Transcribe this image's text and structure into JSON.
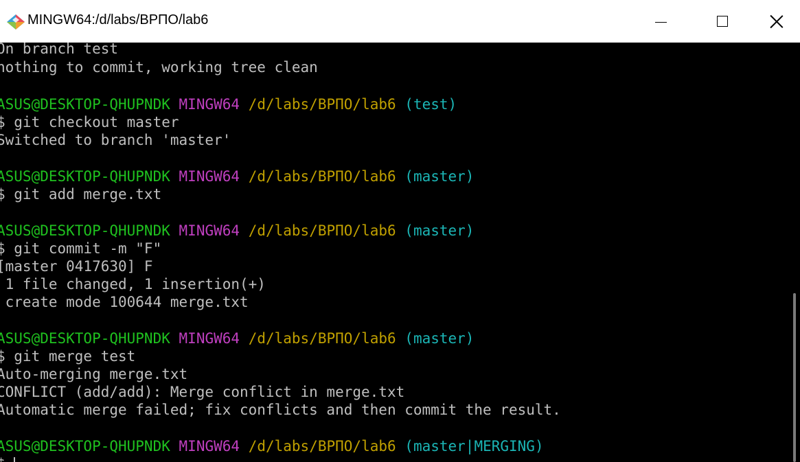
{
  "window": {
    "title": "MINGW64:/d/labs/ВРПО/lab6",
    "icon": "git-bash-icon",
    "controls": [
      "minimize-icon",
      "maximize-icon",
      "close-icon"
    ]
  },
  "colors": {
    "user": "#1fc11f",
    "system": "#bf3fbf",
    "path": "#c0a000",
    "branch": "#1bb5b5",
    "text": "#bfbfbf",
    "background": "#000000"
  },
  "terminal": {
    "line1": "On branch test",
    "line2": "nothing to commit, working tree clean",
    "prompt1": {
      "user": "ASUS@DESKTOP-QHUPNDK",
      "system": "MINGW64",
      "path": "/d/labs/ВРПО/lab6",
      "branch": "(test)"
    },
    "cmd1": "$ git checkout master",
    "out1": "Switched to branch 'master'",
    "prompt2": {
      "user": "ASUS@DESKTOP-QHUPNDK",
      "system": "MINGW64",
      "path": "/d/labs/ВРПО/lab6",
      "branch": "(master)"
    },
    "cmd2": "$ git add merge.txt",
    "prompt3": {
      "user": "ASUS@DESKTOP-QHUPNDK",
      "system": "MINGW64",
      "path": "/d/labs/ВРПО/lab6",
      "branch": "(master)"
    },
    "cmd3": "$ git commit -m \"F\"",
    "out3a": "[master 0417630] F",
    "out3b": " 1 file changed, 1 insertion(+)",
    "out3c": " create mode 100644 merge.txt",
    "prompt4": {
      "user": "ASUS@DESKTOP-QHUPNDK",
      "system": "MINGW64",
      "path": "/d/labs/ВРПО/lab6",
      "branch": "(master)"
    },
    "cmd4": "$ git merge test",
    "out4a": "Auto-merging merge.txt",
    "out4b": "CONFLICT (add/add): Merge conflict in merge.txt",
    "out4c": "Automatic merge failed; fix conflicts and then commit the result.",
    "prompt5": {
      "user": "ASUS@DESKTOP-QHUPNDK",
      "system": "MINGW64",
      "path": "/d/labs/ВРПО/lab6",
      "branch": "(master|MERGING)"
    },
    "current_input": "$ "
  }
}
